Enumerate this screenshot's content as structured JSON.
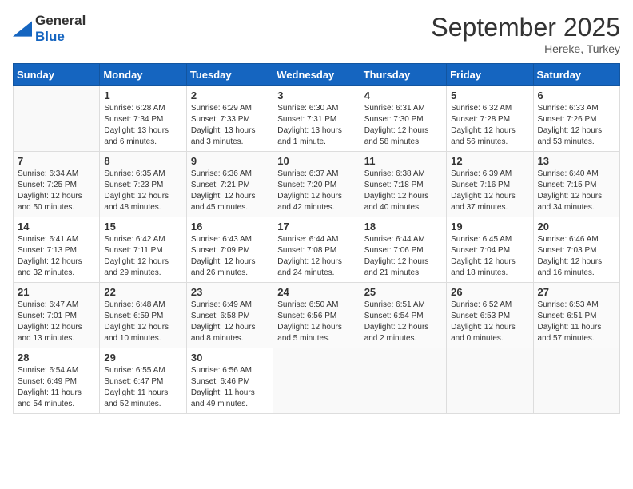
{
  "header": {
    "logo_general": "General",
    "logo_blue": "Blue",
    "month_title": "September 2025",
    "location": "Hereke, Turkey"
  },
  "weekdays": [
    "Sunday",
    "Monday",
    "Tuesday",
    "Wednesday",
    "Thursday",
    "Friday",
    "Saturday"
  ],
  "weeks": [
    [
      {
        "day": "",
        "info": ""
      },
      {
        "day": "1",
        "info": "Sunrise: 6:28 AM\nSunset: 7:34 PM\nDaylight: 13 hours\nand 6 minutes."
      },
      {
        "day": "2",
        "info": "Sunrise: 6:29 AM\nSunset: 7:33 PM\nDaylight: 13 hours\nand 3 minutes."
      },
      {
        "day": "3",
        "info": "Sunrise: 6:30 AM\nSunset: 7:31 PM\nDaylight: 13 hours\nand 1 minute."
      },
      {
        "day": "4",
        "info": "Sunrise: 6:31 AM\nSunset: 7:30 PM\nDaylight: 12 hours\nand 58 minutes."
      },
      {
        "day": "5",
        "info": "Sunrise: 6:32 AM\nSunset: 7:28 PM\nDaylight: 12 hours\nand 56 minutes."
      },
      {
        "day": "6",
        "info": "Sunrise: 6:33 AM\nSunset: 7:26 PM\nDaylight: 12 hours\nand 53 minutes."
      }
    ],
    [
      {
        "day": "7",
        "info": "Sunrise: 6:34 AM\nSunset: 7:25 PM\nDaylight: 12 hours\nand 50 minutes."
      },
      {
        "day": "8",
        "info": "Sunrise: 6:35 AM\nSunset: 7:23 PM\nDaylight: 12 hours\nand 48 minutes."
      },
      {
        "day": "9",
        "info": "Sunrise: 6:36 AM\nSunset: 7:21 PM\nDaylight: 12 hours\nand 45 minutes."
      },
      {
        "day": "10",
        "info": "Sunrise: 6:37 AM\nSunset: 7:20 PM\nDaylight: 12 hours\nand 42 minutes."
      },
      {
        "day": "11",
        "info": "Sunrise: 6:38 AM\nSunset: 7:18 PM\nDaylight: 12 hours\nand 40 minutes."
      },
      {
        "day": "12",
        "info": "Sunrise: 6:39 AM\nSunset: 7:16 PM\nDaylight: 12 hours\nand 37 minutes."
      },
      {
        "day": "13",
        "info": "Sunrise: 6:40 AM\nSunset: 7:15 PM\nDaylight: 12 hours\nand 34 minutes."
      }
    ],
    [
      {
        "day": "14",
        "info": "Sunrise: 6:41 AM\nSunset: 7:13 PM\nDaylight: 12 hours\nand 32 minutes."
      },
      {
        "day": "15",
        "info": "Sunrise: 6:42 AM\nSunset: 7:11 PM\nDaylight: 12 hours\nand 29 minutes."
      },
      {
        "day": "16",
        "info": "Sunrise: 6:43 AM\nSunset: 7:09 PM\nDaylight: 12 hours\nand 26 minutes."
      },
      {
        "day": "17",
        "info": "Sunrise: 6:44 AM\nSunset: 7:08 PM\nDaylight: 12 hours\nand 24 minutes."
      },
      {
        "day": "18",
        "info": "Sunrise: 6:44 AM\nSunset: 7:06 PM\nDaylight: 12 hours\nand 21 minutes."
      },
      {
        "day": "19",
        "info": "Sunrise: 6:45 AM\nSunset: 7:04 PM\nDaylight: 12 hours\nand 18 minutes."
      },
      {
        "day": "20",
        "info": "Sunrise: 6:46 AM\nSunset: 7:03 PM\nDaylight: 12 hours\nand 16 minutes."
      }
    ],
    [
      {
        "day": "21",
        "info": "Sunrise: 6:47 AM\nSunset: 7:01 PM\nDaylight: 12 hours\nand 13 minutes."
      },
      {
        "day": "22",
        "info": "Sunrise: 6:48 AM\nSunset: 6:59 PM\nDaylight: 12 hours\nand 10 minutes."
      },
      {
        "day": "23",
        "info": "Sunrise: 6:49 AM\nSunset: 6:58 PM\nDaylight: 12 hours\nand 8 minutes."
      },
      {
        "day": "24",
        "info": "Sunrise: 6:50 AM\nSunset: 6:56 PM\nDaylight: 12 hours\nand 5 minutes."
      },
      {
        "day": "25",
        "info": "Sunrise: 6:51 AM\nSunset: 6:54 PM\nDaylight: 12 hours\nand 2 minutes."
      },
      {
        "day": "26",
        "info": "Sunrise: 6:52 AM\nSunset: 6:53 PM\nDaylight: 12 hours\nand 0 minutes."
      },
      {
        "day": "27",
        "info": "Sunrise: 6:53 AM\nSunset: 6:51 PM\nDaylight: 11 hours\nand 57 minutes."
      }
    ],
    [
      {
        "day": "28",
        "info": "Sunrise: 6:54 AM\nSunset: 6:49 PM\nDaylight: 11 hours\nand 54 minutes."
      },
      {
        "day": "29",
        "info": "Sunrise: 6:55 AM\nSunset: 6:47 PM\nDaylight: 11 hours\nand 52 minutes."
      },
      {
        "day": "30",
        "info": "Sunrise: 6:56 AM\nSunset: 6:46 PM\nDaylight: 11 hours\nand 49 minutes."
      },
      {
        "day": "",
        "info": ""
      },
      {
        "day": "",
        "info": ""
      },
      {
        "day": "",
        "info": ""
      },
      {
        "day": "",
        "info": ""
      }
    ]
  ]
}
